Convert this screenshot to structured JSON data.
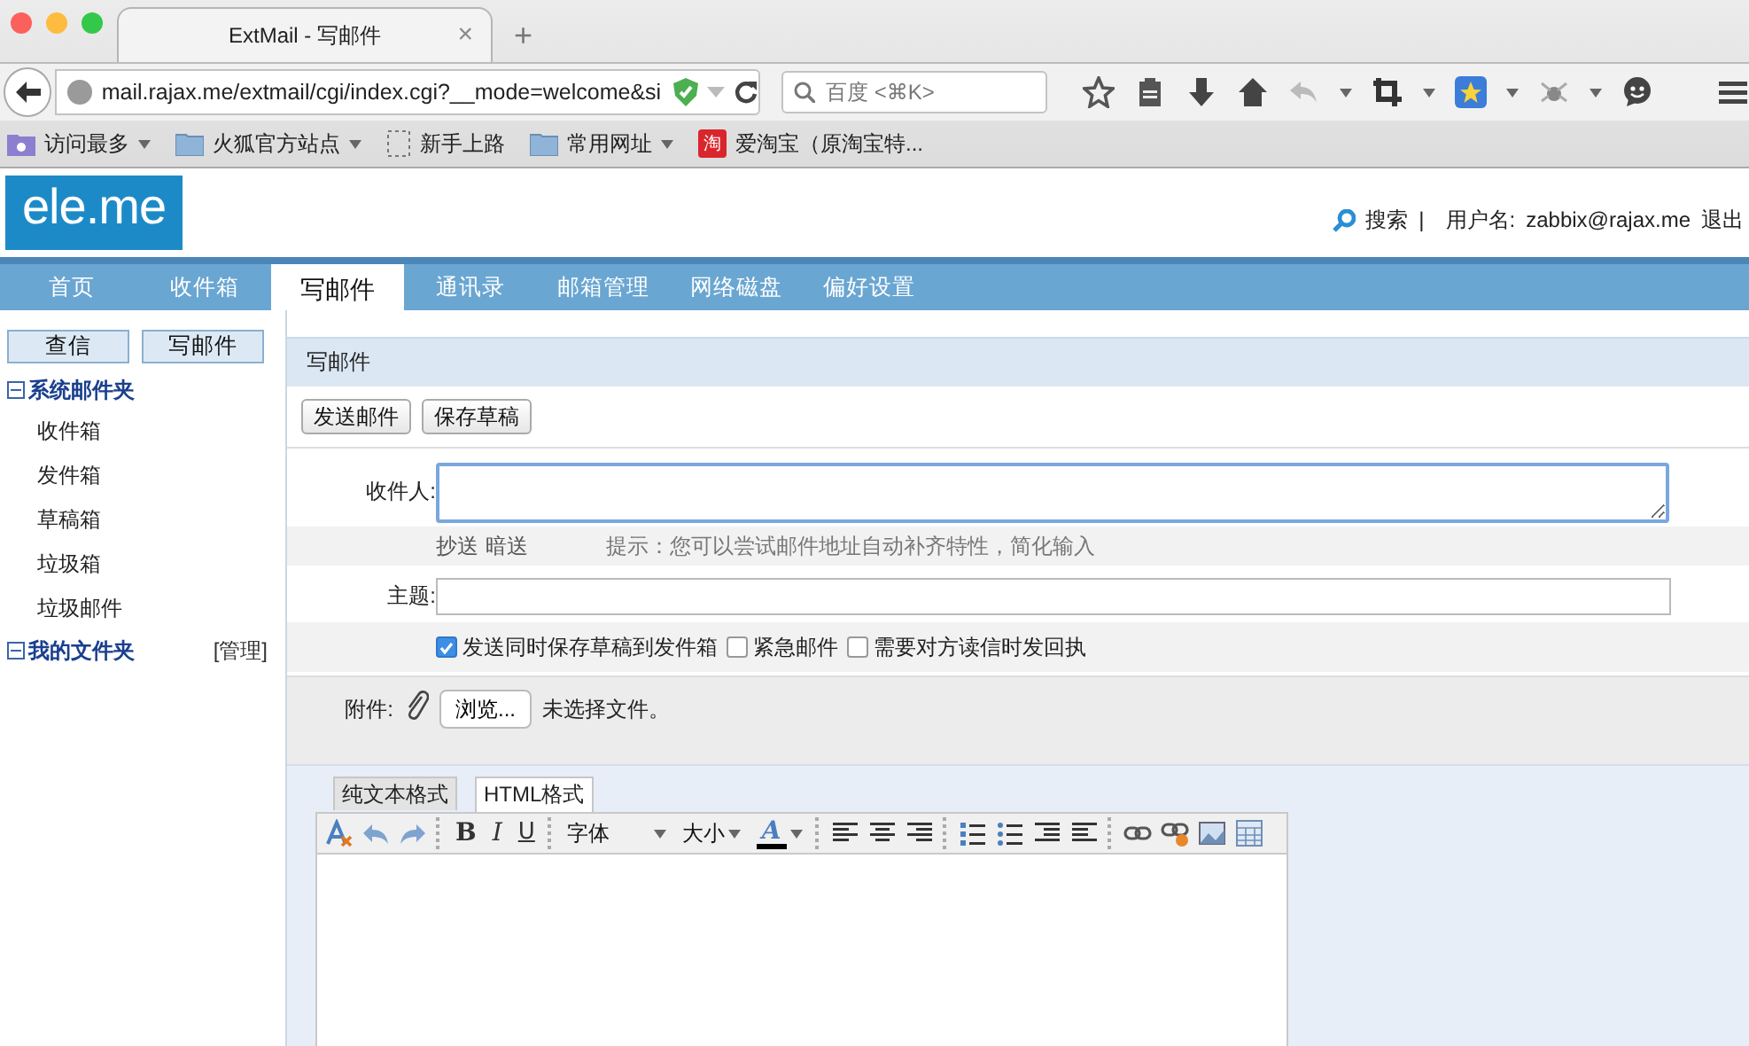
{
  "browser": {
    "tab_title": "ExtMail - 写邮件",
    "tab_close": "×",
    "new_tab": "+",
    "url": "mail.rajax.me/extmail/cgi/index.cgi?__mode=welcome&si",
    "search": {
      "placeholder": "百度 <⌘K>"
    },
    "bookmarks": [
      {
        "label": "访问最多",
        "dropdown": true
      },
      {
        "label": "火狐官方站点",
        "dropdown": true
      },
      {
        "label": "新手上路",
        "dropdown": false
      },
      {
        "label": "常用网址",
        "dropdown": true
      },
      {
        "label": "爱淘宝（原淘宝特...",
        "dropdown": false,
        "badge": "淘"
      }
    ]
  },
  "header": {
    "logo": "ele.me",
    "search": "搜索",
    "separator": "|",
    "user_label": "用户名:",
    "user": "zabbix@rajax.me",
    "logout": "退出"
  },
  "nav": [
    {
      "label": "首页",
      "selected": false
    },
    {
      "label": "收件箱",
      "selected": false
    },
    {
      "label": "写邮件",
      "selected": true
    },
    {
      "label": "通讯录",
      "selected": false
    },
    {
      "label": "邮箱管理",
      "selected": false
    },
    {
      "label": "网络磁盘",
      "selected": false
    },
    {
      "label": "偏好设置",
      "selected": false
    }
  ],
  "sidebar": {
    "buttons": [
      "查信",
      "写邮件"
    ],
    "folders": [
      {
        "label": "系统邮件夹",
        "expanded": true,
        "children": [
          {
            "label": "收件箱"
          },
          {
            "label": "发件箱"
          },
          {
            "label": "草稿箱"
          },
          {
            "label": "垃圾箱"
          },
          {
            "label": "垃圾邮件"
          }
        ]
      },
      {
        "label": "我的文件夹",
        "expanded": true,
        "action": "[管理]"
      }
    ]
  },
  "compose": {
    "title": "写邮件",
    "buttons": [
      "发送邮件",
      "保存草稿"
    ],
    "to_label": "收件人:",
    "cc": "抄送",
    "bcc": "暗送",
    "hint": "提示：您可以尝试邮件地址自动补齐特性，简化输入",
    "subject_label": "主题:",
    "options": [
      {
        "label": "发送同时保存草稿到发件箱",
        "checked": true
      },
      {
        "label": "紧急邮件",
        "checked": false
      },
      {
        "label": "需要对方读信时发回执",
        "checked": false
      }
    ],
    "attach_label": "附件:",
    "browse": "浏览...",
    "no_file": "未选择文件。",
    "editor_tabs": [
      {
        "label": "纯文本格式",
        "selected": false
      },
      {
        "label": "HTML格式",
        "selected": true
      }
    ],
    "toolbar": {
      "bold": "B",
      "italic": "I",
      "underline": "U",
      "font": "字体",
      "size": "大小",
      "color_glyph": "A"
    }
  }
}
